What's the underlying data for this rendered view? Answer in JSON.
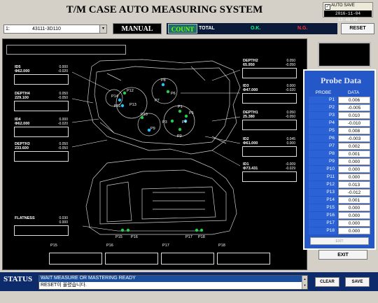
{
  "app": {
    "title": "T/M CASE AUTO MEASURING SYSTEM"
  },
  "autosave": {
    "label": "AUTO SAVE",
    "checked_mark": "✓",
    "datetime": "2016-11-04 13:46:57"
  },
  "model_select": {
    "index": "1:",
    "value": "43111-3D110",
    "dropdown_glyph": "▾"
  },
  "mode": {
    "label": "MANUAL"
  },
  "counters": {
    "count_label": "COUNT",
    "total_label": "TOTAL",
    "ok_label": "O.K.",
    "ng_label": "N.G."
  },
  "buttons": {
    "reset": "RESET",
    "exit_disabled": "EXIT",
    "exit": "EXIT",
    "clear": "CLEAR",
    "save": "SAVE"
  },
  "measurements": [
    {
      "id": "id5",
      "name": "ID5",
      "nominal": "Φ62.000",
      "tol_upper": "0.000",
      "tol_lower": "-0.020"
    },
    {
      "id": "depth4",
      "name": "DEPTH4",
      "nominal": "229.100",
      "tol_upper": "0.050",
      "tol_lower": "-0.050"
    },
    {
      "id": "id4",
      "name": "ID4",
      "nominal": "Φ62.000",
      "tol_upper": "0.000",
      "tol_lower": "-0.020"
    },
    {
      "id": "depth3",
      "name": "DEPTH3",
      "nominal": "233.600",
      "tol_upper": "0.050",
      "tol_lower": "-0.050"
    },
    {
      "id": "depth2",
      "name": "DEPTH2",
      "nominal": "65.950",
      "tol_upper": "0.050",
      "tol_lower": "-0.050"
    },
    {
      "id": "id3",
      "name": "ID3",
      "nominal": "Φ47.000",
      "tol_upper": "0.000",
      "tol_lower": "-0.020"
    },
    {
      "id": "depth1",
      "name": "DEPTH1",
      "nominal": "25.380",
      "tol_upper": "0.050",
      "tol_lower": "-0.050"
    },
    {
      "id": "id2",
      "name": "ID2",
      "nominal": "Φ61.000",
      "tol_upper": "0.045",
      "tol_lower": "0.000"
    },
    {
      "id": "id1",
      "name": "ID1",
      "nominal": "Φ73.431",
      "tol_upper": "-0.009",
      "tol_lower": "-0.029"
    },
    {
      "id": "flatness",
      "name": "FLATNESS",
      "nominal": "",
      "tol_upper": "0.030",
      "tol_lower": "0.000"
    }
  ],
  "bottom_probe_labels": [
    "P15",
    "P16",
    "P17",
    "P18"
  ],
  "diagram_labels": [
    "P1",
    "P2",
    "P3",
    "P4",
    "P5",
    "P6",
    "P7",
    "P8",
    "P9",
    "P10",
    "P11",
    "P12",
    "P13",
    "P14",
    "P15",
    "P16",
    "P17",
    "P18"
  ],
  "probe_table": {
    "title": "Probe Data",
    "headers": [
      "PROBE",
      "DATA"
    ],
    "rows": [
      {
        "probe": "P1",
        "data": "0.006"
      },
      {
        "probe": "P2",
        "data": "-0.005"
      },
      {
        "probe": "P3",
        "data": "0.010"
      },
      {
        "probe": "P4",
        "data": "-0.010"
      },
      {
        "probe": "P5",
        "data": "0.008"
      },
      {
        "probe": "P6",
        "data": "-0.003"
      },
      {
        "probe": "P7",
        "data": "0.002"
      },
      {
        "probe": "P8",
        "data": "0.001"
      },
      {
        "probe": "P9",
        "data": "0.000"
      },
      {
        "probe": "P10",
        "data": "0.000"
      },
      {
        "probe": "P11",
        "data": "0.000"
      },
      {
        "probe": "P12",
        "data": "0.013"
      },
      {
        "probe": "P13",
        "data": "-0.012"
      },
      {
        "probe": "P14",
        "data": "0.001"
      },
      {
        "probe": "P15",
        "data": "0.000"
      },
      {
        "probe": "P16",
        "data": "0.000"
      },
      {
        "probe": "P17",
        "data": "0.000"
      },
      {
        "probe": "P18",
        "data": "0.000"
      }
    ]
  },
  "status": {
    "label": "STATUS",
    "line1": "WAIT MEASURE OR MASTERING READY",
    "line2": "RESET이 올렸습니다."
  },
  "colors": {
    "probe_panel": "#2458c8",
    "count_green": "#7fff00",
    "ok_green": "#00ff7f",
    "ng_red": "#ff3030",
    "status_bg": "#0d2b6b"
  }
}
